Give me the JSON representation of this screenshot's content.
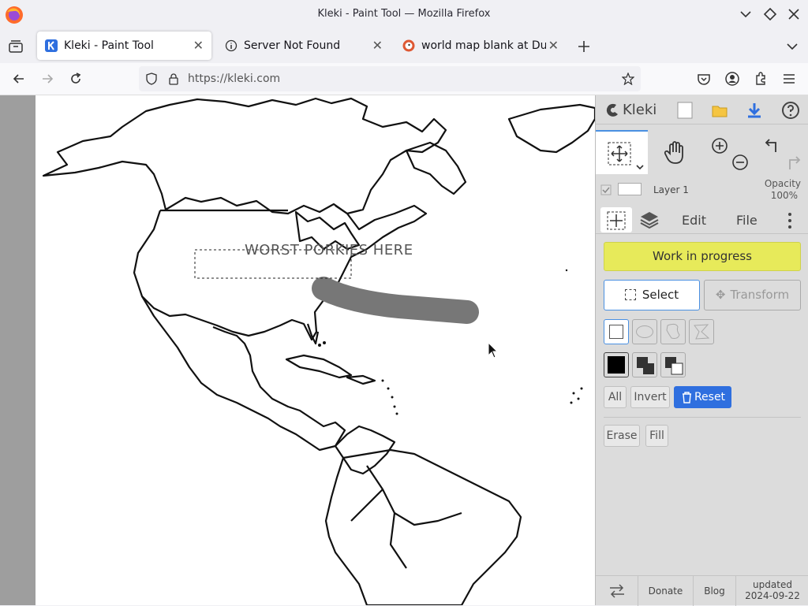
{
  "window": {
    "title": "Kleki - Paint Tool — Mozilla Firefox"
  },
  "tabs": [
    {
      "label": "Kleki - Paint Tool",
      "active": true
    },
    {
      "label": "Server Not Found",
      "active": false
    },
    {
      "label": "world map blank at DuckDuckGo",
      "active": false
    }
  ],
  "nav": {
    "url": "https://kleki.com"
  },
  "canvas": {
    "text_overlay": "WORST PORKIES HERE"
  },
  "panel": {
    "logo": "Kleki",
    "layer": {
      "name": "Layer 1",
      "opacity_label": "Opacity",
      "opacity_value": "100%"
    },
    "tabs": {
      "edit": "Edit",
      "file": "File"
    },
    "status": "Work in progress",
    "select_label": "Select",
    "transform_label": "Transform",
    "buttons": {
      "all": "All",
      "invert": "Invert",
      "reset": "Reset",
      "erase": "Erase",
      "fill": "Fill"
    },
    "bottom": {
      "donate": "Donate",
      "blog": "Blog",
      "updated_label": "updated",
      "updated_date": "2024-09-22"
    }
  },
  "colors": {
    "accent": "#2f6fdf",
    "status_yellow": "#e7ea5a",
    "stroke_gray": "#777777"
  }
}
